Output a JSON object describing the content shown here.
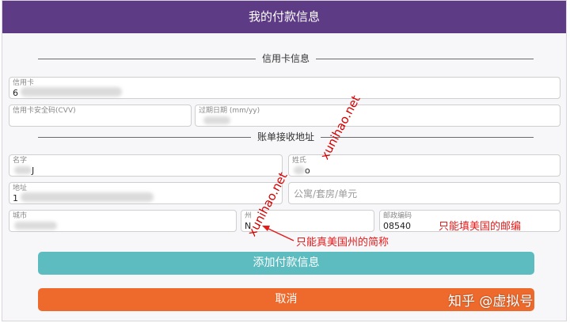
{
  "header": {
    "title": "我的付款信息"
  },
  "sections": {
    "credit_card": "信用卡信息",
    "billing_address": "账单接收地址"
  },
  "fields": {
    "card_number": {
      "label": "信用卡",
      "value": "6"
    },
    "cvv": {
      "label": "信用卡安全码(CVV)"
    },
    "expiry": {
      "label": "过期日期",
      "hint": "(mm/yy)"
    },
    "first_name": {
      "label": "名字",
      "value": "J"
    },
    "last_name": {
      "label": "姓氏",
      "value": "o"
    },
    "address": {
      "label": "地址",
      "value": "1"
    },
    "apt": {
      "placeholder": "公寓/套房/单元"
    },
    "city": {
      "label": "城市"
    },
    "state": {
      "label": "州",
      "value": "N"
    },
    "zip": {
      "label": "邮政编码",
      "value": "08540"
    }
  },
  "buttons": {
    "add_payment": "添加付款信息",
    "cancel": "取消"
  },
  "annotations": {
    "zip_note": "只能填美国的邮编",
    "state_note": "只能真美国州的简称"
  },
  "watermarks": {
    "site_1": "xunihao.net",
    "site_2": "xunihao.net",
    "zhihu": "知乎 @虚拟号"
  },
  "colors": {
    "header": "#5e3b85",
    "add_button": "#5dbcc0",
    "cancel_button": "#ee6a2c",
    "annotation": "#e31b1b"
  }
}
